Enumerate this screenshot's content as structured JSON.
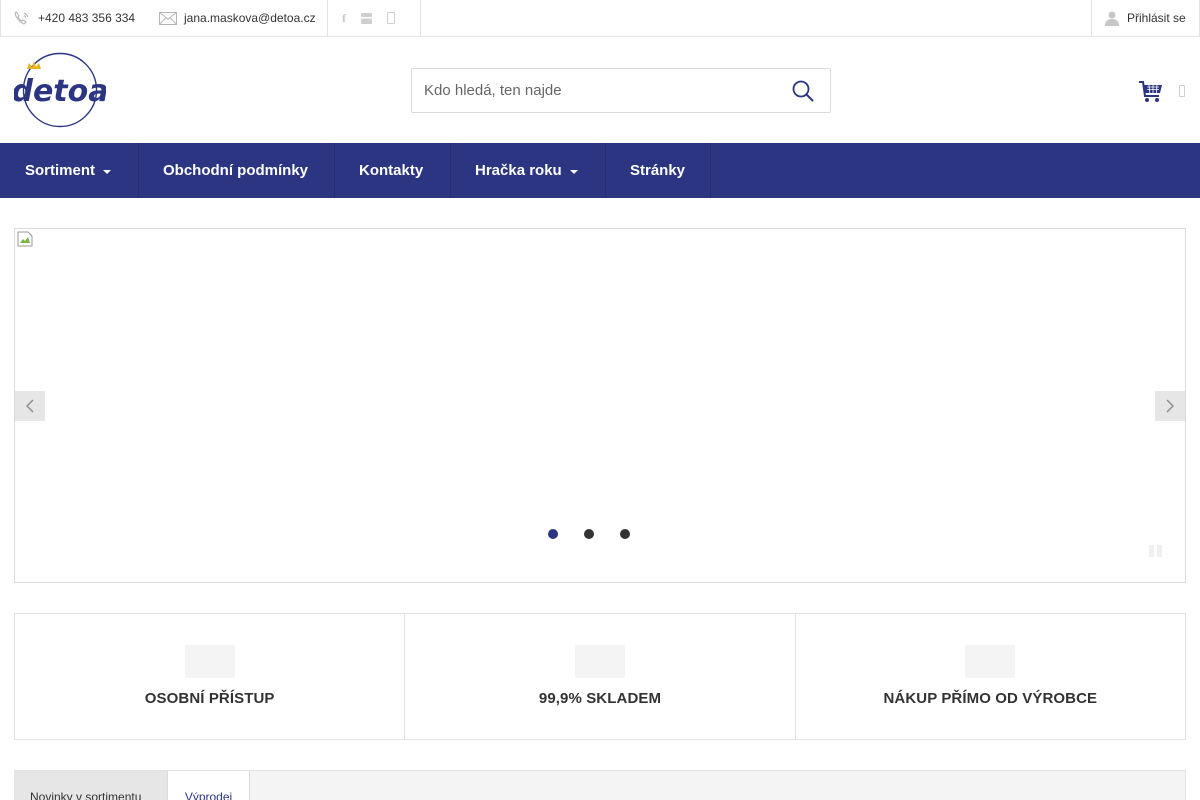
{
  "topbar": {
    "phone": "+420 483 356 334",
    "email": "jana.maskova@detoa.cz",
    "social_icons": [
      "facebook-icon",
      "youtube-icon",
      "instagram-icon"
    ],
    "login_label": "Přihlásit se"
  },
  "header": {
    "logo_text": "detoa",
    "search_placeholder": "Kdo hledá, ten najde",
    "cart_icon": "cart-icon"
  },
  "nav": {
    "items": [
      {
        "label": "Sortiment",
        "dropdown": true
      },
      {
        "label": "Obchodní podmínky",
        "dropdown": false
      },
      {
        "label": "Kontakty",
        "dropdown": false
      },
      {
        "label": "Hračka roku",
        "dropdown": true
      },
      {
        "label": "Stránky",
        "dropdown": false
      }
    ]
  },
  "slider": {
    "slides_count": 3,
    "active_slide": 1
  },
  "benefits": [
    {
      "label": "OSOBNÍ PŘÍSTUP"
    },
    {
      "label": "99,9% SKLADEM"
    },
    {
      "label": "NÁKUP PŘÍMO OD VÝROBCE"
    }
  ],
  "tabs": [
    {
      "label": "Novinky v sortimentu",
      "active": true
    },
    {
      "label": "Výprodej",
      "active": false
    }
  ],
  "colors": {
    "brand": "#2b3582",
    "border": "#e3e3e3"
  }
}
